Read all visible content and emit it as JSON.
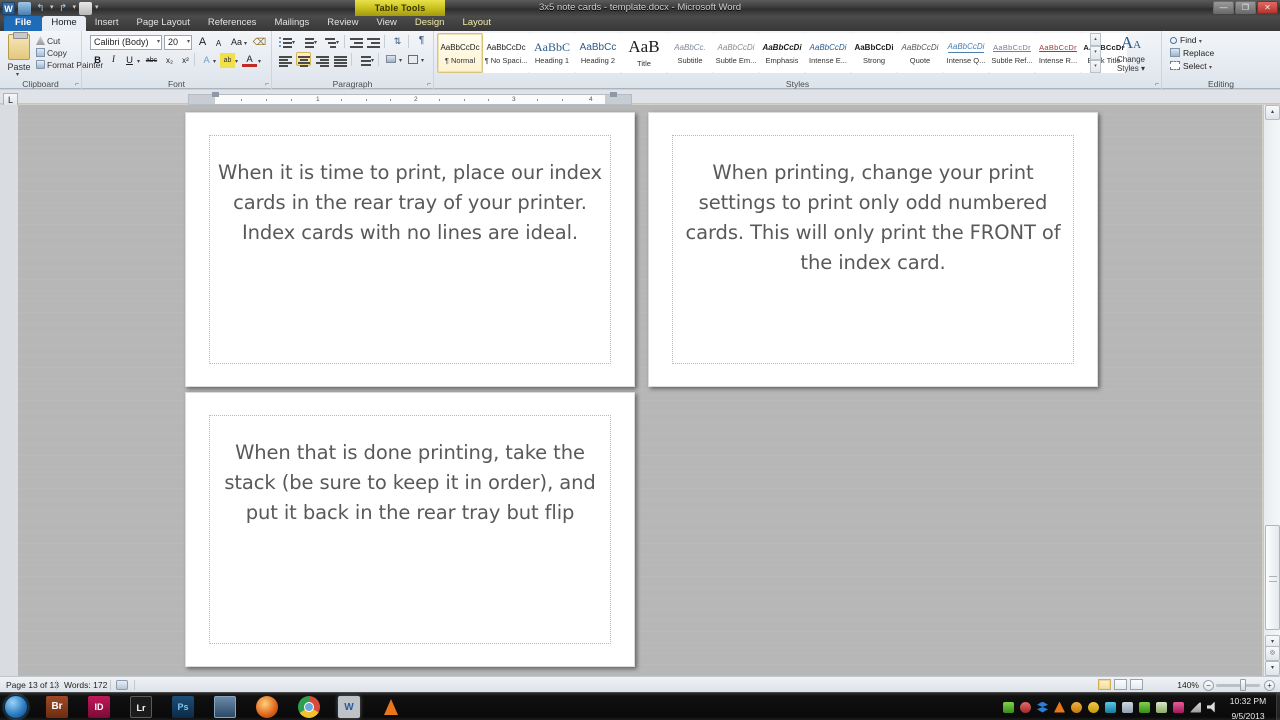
{
  "window": {
    "title": "3x5 note cards - template.docx - Microsoft Word",
    "contextual_tab_banner": "Table Tools",
    "controls": {
      "minimize": "—",
      "restore": "❐",
      "close": "✕"
    }
  },
  "quick_access": {
    "app_icon": "word-icon",
    "items": [
      {
        "name": "save-icon",
        "label": "Save"
      },
      {
        "name": "undo-icon",
        "label": "↰"
      },
      {
        "name": "undo-dropdown-icon",
        "label": "▾"
      },
      {
        "name": "redo-icon",
        "label": "↱"
      },
      {
        "name": "print-preview-icon",
        "label": "Print Preview"
      },
      {
        "name": "customize-qat-icon",
        "label": "▾"
      }
    ]
  },
  "ribbon": {
    "tabs": [
      {
        "label": "File",
        "state": "file"
      },
      {
        "label": "Home",
        "state": "active"
      },
      {
        "label": "Insert",
        "state": "normal"
      },
      {
        "label": "Page Layout",
        "state": "normal"
      },
      {
        "label": "References",
        "state": "normal"
      },
      {
        "label": "Mailings",
        "state": "normal"
      },
      {
        "label": "Review",
        "state": "normal"
      },
      {
        "label": "View",
        "state": "normal"
      },
      {
        "label": "Design",
        "state": "contextual"
      },
      {
        "label": "Layout",
        "state": "contextual"
      }
    ],
    "clipboard": {
      "group_label": "Clipboard",
      "paste_label": "Paste",
      "paste_caret": "▾",
      "items": [
        {
          "label": "Cut",
          "icon": "scissors-icon"
        },
        {
          "label": "Copy",
          "icon": "copy-icon"
        },
        {
          "label": "Format Painter",
          "icon": "format-painter-icon"
        }
      ],
      "dialog_launcher": "⌐"
    },
    "font": {
      "group_label": "Font",
      "font_name": "Calibri (Body)",
      "font_size": "20",
      "caret": "▾",
      "buttons": [
        {
          "name": "grow-font-button",
          "label": "A"
        },
        {
          "name": "shrink-font-button",
          "label": "A"
        },
        {
          "name": "change-case-button",
          "label": "Aa"
        },
        {
          "name": "clear-formatting-button",
          "label": "⌫"
        },
        {
          "name": "bold-button",
          "label": "B"
        },
        {
          "name": "italic-button",
          "label": "I"
        },
        {
          "name": "underline-button",
          "label": "U"
        },
        {
          "name": "strikethrough-button",
          "label": "abc"
        },
        {
          "name": "subscript-button",
          "label": "x₂"
        },
        {
          "name": "superscript-button",
          "label": "x²"
        },
        {
          "name": "text-effects-button",
          "label": "A"
        },
        {
          "name": "highlight-color-button",
          "label": "ab"
        },
        {
          "name": "font-color-button",
          "label": "A"
        }
      ],
      "dialog_launcher": "⌐"
    },
    "paragraph": {
      "group_label": "Paragraph",
      "buttons": [
        {
          "name": "bullets-button",
          "label": "Bullets"
        },
        {
          "name": "numbering-button",
          "label": "Numbering"
        },
        {
          "name": "multilevel-list-button",
          "label": "Multilevel List"
        },
        {
          "name": "decrease-indent-button",
          "label": "Decrease Indent"
        },
        {
          "name": "increase-indent-button",
          "label": "Increase Indent"
        },
        {
          "name": "sort-button",
          "label": "Sort"
        },
        {
          "name": "show-marks-button",
          "label": "¶"
        },
        {
          "name": "align-left-button",
          "label": "Align Left"
        },
        {
          "name": "align-center-button",
          "label": "Center",
          "active": true
        },
        {
          "name": "align-right-button",
          "label": "Align Right"
        },
        {
          "name": "justify-button",
          "label": "Justify"
        },
        {
          "name": "line-spacing-button",
          "label": "Line Spacing"
        },
        {
          "name": "shading-button",
          "label": "Shading"
        },
        {
          "name": "borders-button",
          "label": "Borders"
        }
      ],
      "dialog_launcher": "⌐"
    },
    "styles": {
      "group_label": "Styles",
      "gallery": [
        {
          "sample": "AaBbCcDc",
          "name": "¶ Normal",
          "selected": true,
          "style": "normal"
        },
        {
          "sample": "AaBbCcDc",
          "name": "¶ No Spaci...",
          "style": "normal"
        },
        {
          "sample": "AaBbC",
          "name": "Heading 1",
          "style": "h1"
        },
        {
          "sample": "AaBbCc",
          "name": "Heading 2",
          "style": "h2"
        },
        {
          "sample": "AaB",
          "name": "Title",
          "style": "title"
        },
        {
          "sample": "AaBbCc.",
          "name": "Subtitle",
          "style": "subtitle"
        },
        {
          "sample": "AaBbCcDi",
          "name": "Subtle Em...",
          "style": "subtle-em"
        },
        {
          "sample": "AaBbCcDi",
          "name": "Emphasis",
          "style": "emphasis"
        },
        {
          "sample": "AaBbCcDi",
          "name": "Intense E...",
          "style": "intense-em"
        },
        {
          "sample": "AaBbCcDi",
          "name": "Strong",
          "style": "strong"
        },
        {
          "sample": "AaBbCcDi",
          "name": "Quote",
          "style": "quote"
        },
        {
          "sample": "AaBbCcDi",
          "name": "Intense Q...",
          "style": "intense-q"
        },
        {
          "sample": "AaBbCcDr",
          "name": "Subtle Ref...",
          "style": "subtle-ref"
        },
        {
          "sample": "AaBbCcDr",
          "name": "Intense R...",
          "style": "intense-ref"
        },
        {
          "sample": "AABBCcDr",
          "name": "Book Title",
          "style": "book-title"
        }
      ],
      "scroll": {
        "up": "▴",
        "down": "▾",
        "more": "▾"
      },
      "change_styles": {
        "label_line1": "Change",
        "label_line2": "Styles",
        "caret": "▾",
        "icon": "change-styles-icon"
      },
      "dialog_launcher": "⌐"
    },
    "editing": {
      "group_label": "Editing",
      "items": [
        {
          "label": "Find",
          "icon": "find-icon",
          "caret": "▾"
        },
        {
          "label": "Replace",
          "icon": "replace-icon",
          "caret": ""
        },
        {
          "label": "Select",
          "icon": "select-icon",
          "caret": "▾"
        }
      ]
    }
  },
  "ruler": {
    "tab_selector": "L",
    "numbers": [
      "1",
      "2",
      "3",
      "4"
    ],
    "unit": "inches"
  },
  "document": {
    "cards": [
      {
        "id": "card-top-left",
        "text": "When it is time to print, place our index cards in the rear tray of your printer.  Index cards with no lines are ideal."
      },
      {
        "id": "card-top-right",
        "text": "When printing, change your print settings to print only odd numbered cards.  This will only print the FRONT of the index card."
      },
      {
        "id": "card-bottom-left",
        "text": "When that is done printing, take the stack (be sure to keep it in order), and put it back in the rear tray but flip"
      }
    ]
  },
  "status_bar": {
    "page": "Page 13 of 13",
    "words": "Words: 172",
    "proofing_icon": "proofing-errors-icon",
    "view_buttons": [
      {
        "name": "print-layout-view-button",
        "label": "Print Layout",
        "selected": true
      },
      {
        "name": "full-screen-reading-view-button",
        "label": "Full Screen Reading"
      },
      {
        "name": "web-layout-view-button",
        "label": "Web Layout"
      },
      {
        "name": "outline-view-button",
        "label": "Outline"
      },
      {
        "name": "draft-view-button",
        "label": "Draft"
      }
    ],
    "zoom": "140%",
    "zoom_out": "−",
    "zoom_in": "+"
  },
  "taskbar": {
    "start": "start-orb-icon",
    "apps": [
      {
        "name": "adobe-bridge-icon",
        "label": "Br",
        "color": "#8a3a1c",
        "active": false
      },
      {
        "name": "adobe-indesign-icon",
        "label": "ID",
        "color": "#a01050",
        "active": false
      },
      {
        "name": "adobe-lightroom-icon",
        "label": "Lr",
        "color": "#1b1b1b",
        "active": false
      },
      {
        "name": "adobe-photoshop-icon",
        "label": "Ps",
        "color": "#123a5c",
        "active": false
      },
      {
        "name": "remote-desktop-icon",
        "label": "",
        "color": "#3c5a78",
        "active": false
      },
      {
        "name": "firefox-icon",
        "label": "",
        "color": "#d95b1a",
        "active": false
      },
      {
        "name": "google-chrome-icon",
        "label": "",
        "color": "#2c8a3c",
        "active": false
      },
      {
        "name": "microsoft-word-icon",
        "label": "W",
        "color": "#2a5a9e",
        "active": true
      },
      {
        "name": "vlc-media-player-icon",
        "label": "",
        "color": "#e8761a",
        "active": false
      }
    ],
    "tray_icons": [
      "dropbox-icon",
      "network-shield-icon",
      "bluetooth-icon",
      "vlc-tray-icon",
      "update-icon",
      "warning-icon",
      "antivirus-icon",
      "cloud-sync-icon",
      "battery-icon",
      "safety-icon",
      "flag-icon",
      "network-signal-icon",
      "volume-icon"
    ],
    "clock_time": "10:32 PM",
    "clock_date": "9/5/2013"
  },
  "colors": {
    "accent": "#1e6bb8",
    "contextual_tab": "#c9c21e",
    "card_text": "#595959",
    "canvas_bg": "#b7b7b7"
  }
}
